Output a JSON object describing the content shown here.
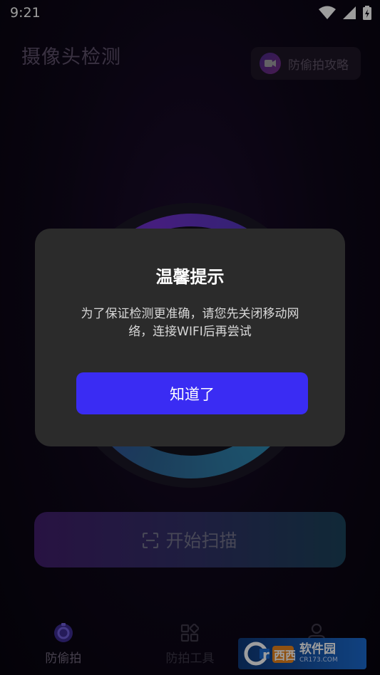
{
  "status_bar": {
    "time": "9:21"
  },
  "header": {
    "title": "摄像头检测",
    "guide_label": "防偷拍攻略"
  },
  "scan": {
    "button_label": "开始扫描"
  },
  "nav": {
    "items": [
      {
        "label": "防偷拍",
        "icon": "camera-icon"
      },
      {
        "label": "防拍工具",
        "icon": "grid-icon"
      },
      {
        "label": "",
        "icon": "user-icon"
      }
    ]
  },
  "dialog": {
    "title": "温馨提示",
    "message": "为了保证检测更准确，请您先关闭移动网络，连接WIFI后再尝试",
    "confirm_label": "知道了"
  },
  "watermark": {
    "brand": "软件园",
    "site": "CR173.COM"
  },
  "colors": {
    "dialog_bg": "#2b2b2b",
    "confirm_button": "#3a2cf3",
    "background": "#0c0614"
  }
}
